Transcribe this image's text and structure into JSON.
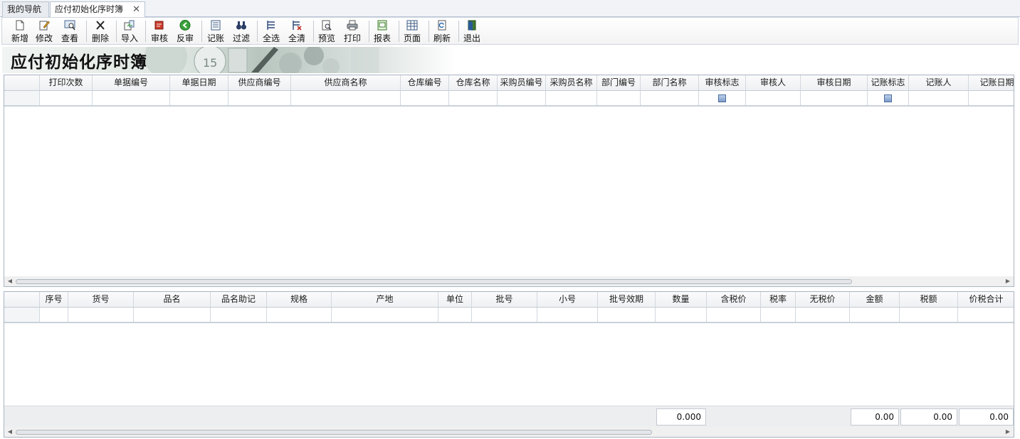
{
  "tabs": [
    {
      "label": "我的导航",
      "active": false
    },
    {
      "label": "应付初始化序时簿",
      "active": true,
      "close": "✕"
    }
  ],
  "toolbar": {
    "new": "新增",
    "edit": "修改",
    "view": "查看",
    "delete": "删除",
    "import": "导入",
    "audit": "审核",
    "unaudit": "反审",
    "post": "记账",
    "filter": "过滤",
    "select_all": "全选",
    "clear_all": "全清",
    "preview": "预览",
    "print": "打印",
    "report": "报表",
    "page": "页面",
    "refresh": "刷新",
    "exit": "退出"
  },
  "banner": {
    "title": "应付初始化序时簿"
  },
  "master_grid": {
    "columns": [
      "打印次数",
      "单据编号",
      "单据日期",
      "供应商编号",
      "供应商名称",
      "仓库编号",
      "仓库名称",
      "采购员编号",
      "采购员名称",
      "部门编号",
      "部门名称",
      "审核标志",
      "审核人",
      "审核日期",
      "记账标志",
      "记账人",
      "记账日期"
    ]
  },
  "detail_grid": {
    "columns": [
      "序号",
      "货号",
      "品名",
      "品名助记",
      "规格",
      "产地",
      "单位",
      "批号",
      "小号",
      "批号效期",
      "数量",
      "含税价",
      "税率",
      "无税价",
      "金额",
      "税额",
      "价税合计"
    ],
    "totals": {
      "quantity": "0.000",
      "amount": "0.00",
      "tax": "0.00",
      "total": "0.00"
    }
  },
  "colors": {
    "accent_border": "#a9b4c1",
    "checkbox": "#7d9cc9",
    "footer_bg": "#edeef0"
  }
}
